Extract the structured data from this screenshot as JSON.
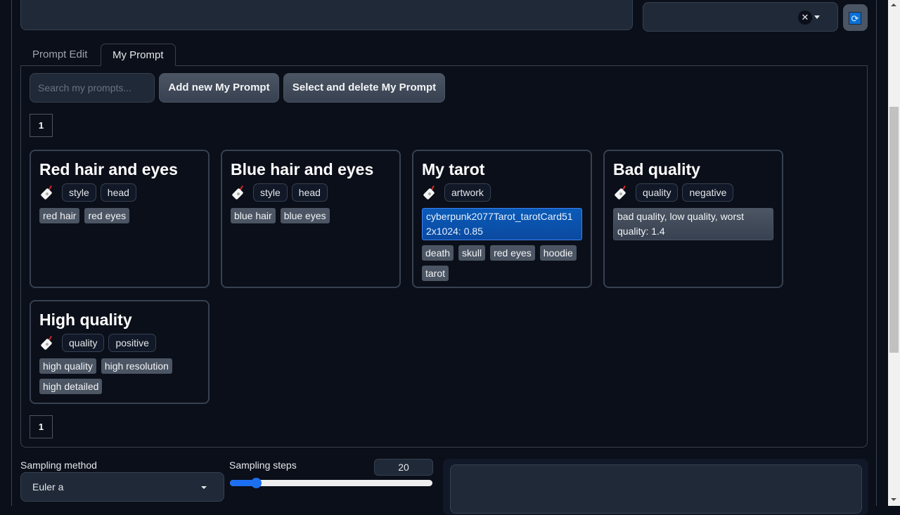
{
  "tabs": [
    {
      "label": "Prompt Edit",
      "active": false
    },
    {
      "label": "My Prompt",
      "active": true
    }
  ],
  "toolbar": {
    "search_placeholder": "Search my prompts...",
    "search_value": "",
    "add_label": "Add new My Prompt",
    "delete_label": "Select and delete My Prompt"
  },
  "pagination": {
    "top_page": "1",
    "bottom_page": "1"
  },
  "icons": {
    "clear": "close-icon",
    "dropdown": "chevron-down-icon",
    "refresh": "refresh-icon",
    "card_tag": "tag-icon"
  },
  "colors": {
    "background": "#0b0f19",
    "panel": "#1f2937",
    "border": "#374151",
    "accent": "#1d6ff2",
    "lora_chip": "#0a5bb8"
  },
  "cards": [
    {
      "title": "Red hair and eyes",
      "tags": [
        "style",
        "head"
      ],
      "prompts": [
        "red hair",
        "red eyes"
      ]
    },
    {
      "title": "Blue hair and eyes",
      "tags": [
        "style",
        "head"
      ],
      "prompts": [
        "blue hair",
        "blue eyes"
      ]
    },
    {
      "title": "My tarot",
      "tags": [
        "artwork"
      ],
      "lora": "cyberpunk2077Tarot_tarotCard512x1024: 0.85",
      "prompts": [
        "death",
        "skull",
        "red eyes",
        "hoodie",
        "tarot"
      ]
    },
    {
      "title": "Bad quality",
      "tags": [
        "quality",
        "negative"
      ],
      "weighted": "bad quality, low quality, worst quality: 1.4"
    },
    {
      "title": "High quality",
      "tags": [
        "quality",
        "positive"
      ],
      "prompts": [
        "high quality",
        "high resolution",
        "high detailed"
      ]
    }
  ],
  "sampling": {
    "method_label": "Sampling method",
    "method_value": "Euler a",
    "steps_label": "Sampling steps",
    "steps_value": "20",
    "steps_min": 1,
    "steps_max": 150
  }
}
